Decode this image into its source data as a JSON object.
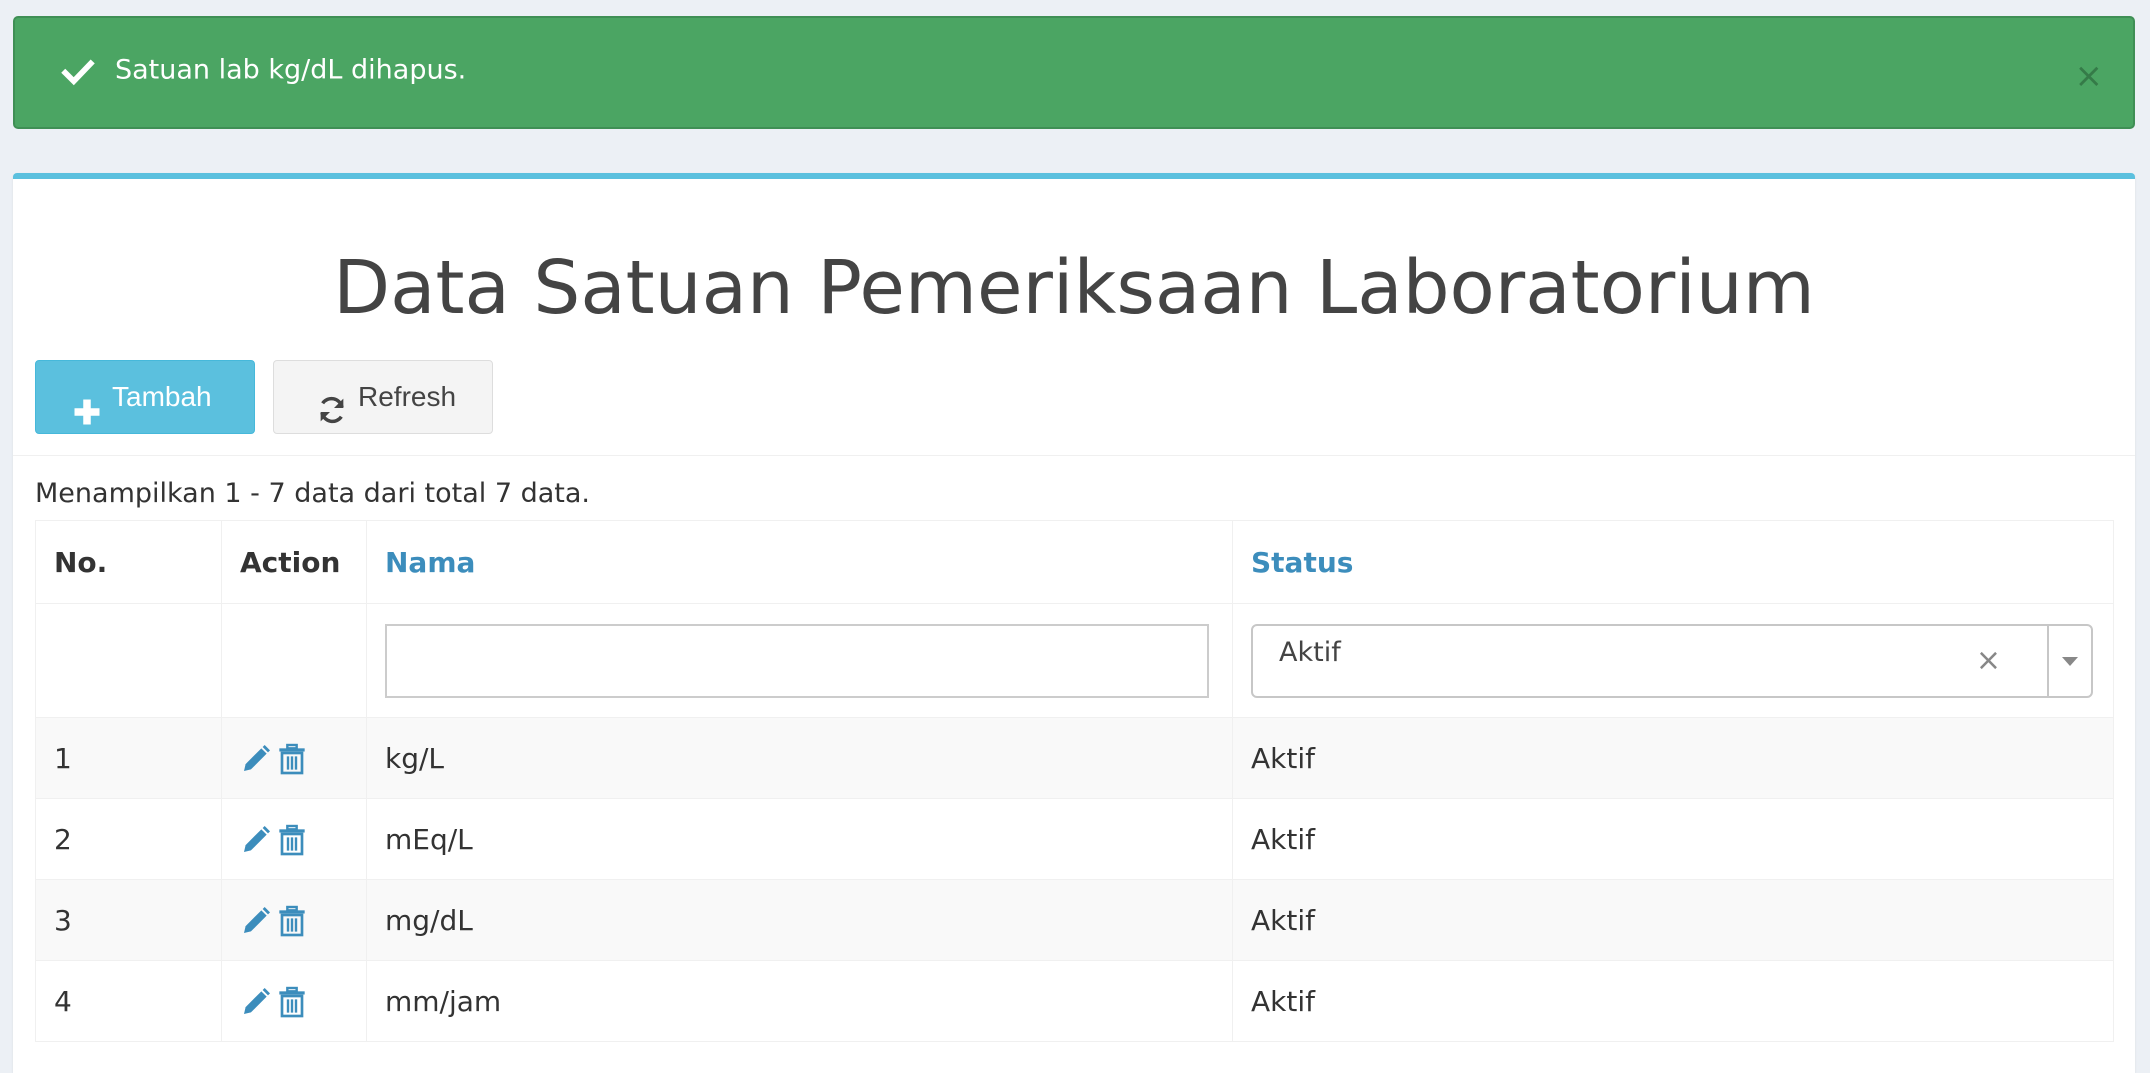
{
  "alert": {
    "message": "Satuan lab kg/dL dihapus.",
    "close_label": "×",
    "check_icon": "check-icon",
    "color": "#4ba563"
  },
  "page": {
    "title": "Data Satuan Pemeriksaan Laboratorium",
    "accent_color": "#5bc0de"
  },
  "toolbar": {
    "add_label": "Tambah",
    "refresh_label": "Refresh",
    "add_icon": "plus-icon",
    "refresh_icon": "refresh-icon"
  },
  "summary": "Menampilkan 1 - 7 data dari total 7 data.",
  "table": {
    "columns": {
      "no": "No.",
      "action": "Action",
      "nama": "Nama",
      "status": "Status"
    },
    "filters": {
      "nama_value": "",
      "status_value": "Aktif",
      "status_clear": "×"
    },
    "rows": [
      {
        "no": "1",
        "nama": "kg/L",
        "status": "Aktif"
      },
      {
        "no": "2",
        "nama": "mEq/L",
        "status": "Aktif"
      },
      {
        "no": "3",
        "nama": "mg/dL",
        "status": "Aktif"
      },
      {
        "no": "4",
        "nama": "mm/jam",
        "status": "Aktif"
      }
    ],
    "row_icons": [
      "pencil-icon",
      "trash-icon"
    ],
    "link_color": "#3c8dbc"
  }
}
